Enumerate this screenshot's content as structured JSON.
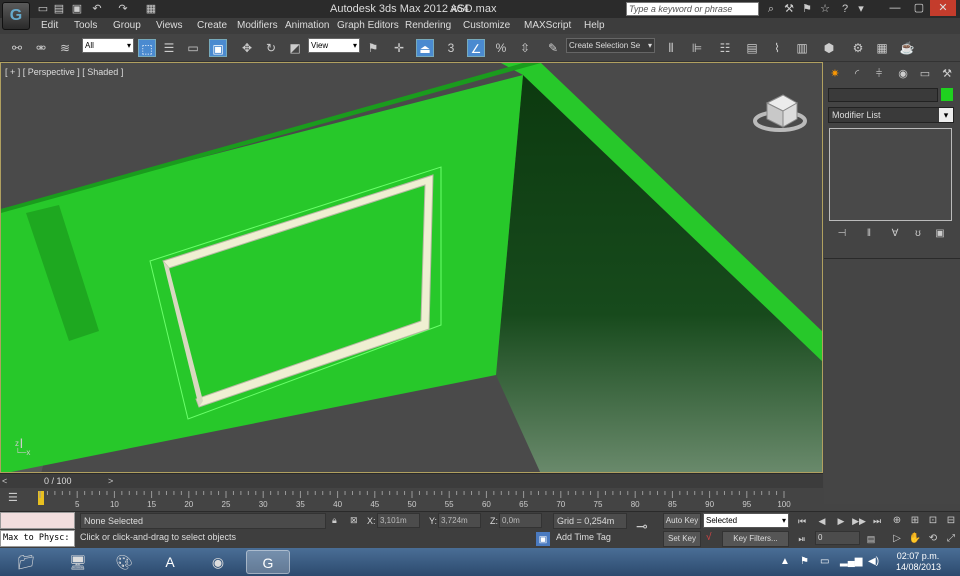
{
  "titlebar": {
    "title": "Autodesk 3ds Max  2012 x64",
    "file": "ASD.max",
    "search_placeholder": "Type a keyword or phrase"
  },
  "menu": {
    "items": [
      "Edit",
      "Tools",
      "Group",
      "Views",
      "Create",
      "Modifiers",
      "Animation",
      "Graph Editors",
      "Rendering",
      "Customize",
      "MAXScript",
      "Help"
    ]
  },
  "toolbar": {
    "filter": "All",
    "ref_coord": "View",
    "angle_snap": "3",
    "selection_set": "Create Selection Se"
  },
  "viewport": {
    "label": "[ + ] [ Perspective ] [ Shaded ]",
    "colors": {
      "wall": "#27c82a",
      "wall_dark": "#0d3d10",
      "floor": "#4a4a4a",
      "frame": "#efefd2"
    }
  },
  "command_panel": {
    "modifier_list": "Modifier List",
    "object_color": "#1fd21f"
  },
  "timeline": {
    "value": "0 / 100",
    "ticks": [
      "5",
      "10",
      "15",
      "20",
      "25",
      "30",
      "35",
      "40",
      "45",
      "50",
      "55",
      "60",
      "65",
      "70",
      "75",
      "80",
      "85",
      "90",
      "95",
      "100"
    ]
  },
  "status": {
    "maxscript": "Max to Physc:",
    "selection": "None Selected",
    "prompt": "Click or click-and-drag to select objects",
    "x_label": "X:",
    "x_val": "3,101m",
    "y_label": "Y:",
    "y_val": "3,724m",
    "z_label": "Z:",
    "z_val": "0,0m",
    "grid": "Grid = 0,254m",
    "add_time_tag": "Add Time Tag",
    "auto_key": "Auto Key",
    "set_key": "Set Key",
    "selected": "Selected",
    "key_filters": "Key Filters..."
  },
  "taskbar": {
    "time": "02:07 p.m.",
    "date": "14/08/2013"
  }
}
